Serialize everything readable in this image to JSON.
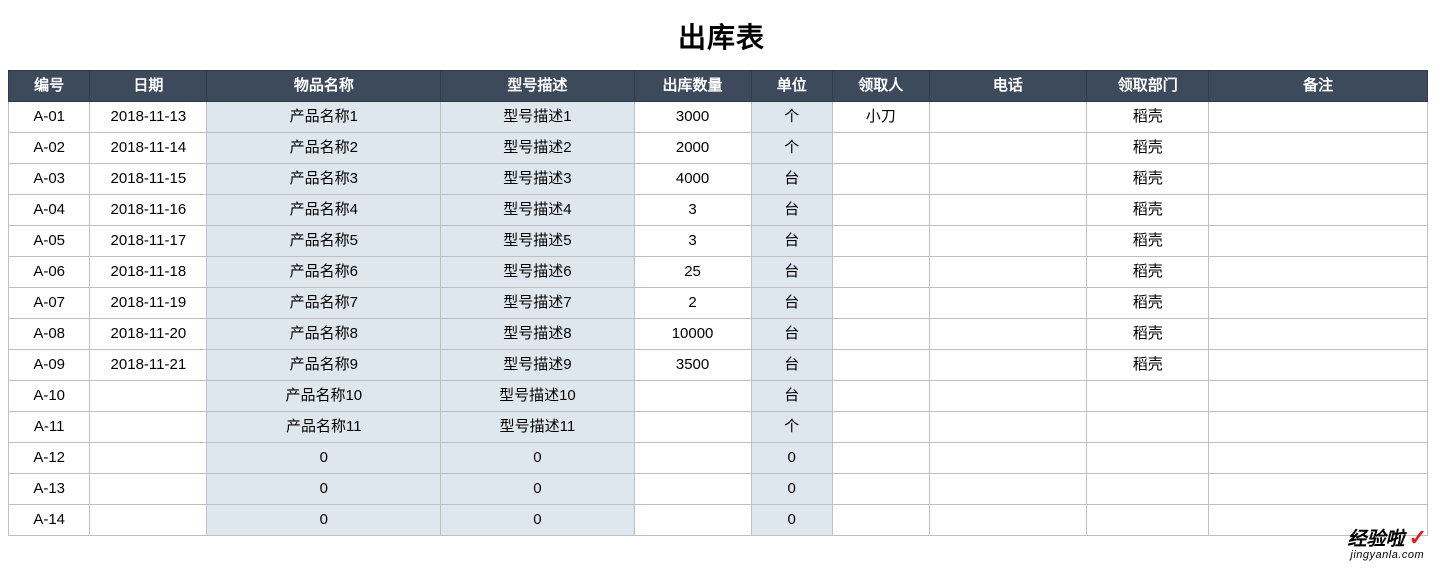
{
  "title": "出库表",
  "headers": [
    "编号",
    "日期",
    "物品名称",
    "型号描述",
    "出库数量",
    "单位",
    "领取人",
    "电话",
    "领取部门",
    "备注"
  ],
  "rows": [
    {
      "id": "A-01",
      "date": "2018-11-13",
      "name": "产品名称1",
      "model": "型号描述1",
      "qty": "3000",
      "unit": "个",
      "receiver": "小刀",
      "phone": "",
      "dept": "稻壳",
      "note": ""
    },
    {
      "id": "A-02",
      "date": "2018-11-14",
      "name": "产品名称2",
      "model": "型号描述2",
      "qty": "2000",
      "unit": "个",
      "receiver": "",
      "phone": "",
      "dept": "稻壳",
      "note": ""
    },
    {
      "id": "A-03",
      "date": "2018-11-15",
      "name": "产品名称3",
      "model": "型号描述3",
      "qty": "4000",
      "unit": "台",
      "receiver": "",
      "phone": "",
      "dept": "稻壳",
      "note": ""
    },
    {
      "id": "A-04",
      "date": "2018-11-16",
      "name": "产品名称4",
      "model": "型号描述4",
      "qty": "3",
      "unit": "台",
      "receiver": "",
      "phone": "",
      "dept": "稻壳",
      "note": ""
    },
    {
      "id": "A-05",
      "date": "2018-11-17",
      "name": "产品名称5",
      "model": "型号描述5",
      "qty": "3",
      "unit": "台",
      "receiver": "",
      "phone": "",
      "dept": "稻壳",
      "note": ""
    },
    {
      "id": "A-06",
      "date": "2018-11-18",
      "name": "产品名称6",
      "model": "型号描述6",
      "qty": "25",
      "unit": "台",
      "receiver": "",
      "phone": "",
      "dept": "稻壳",
      "note": ""
    },
    {
      "id": "A-07",
      "date": "2018-11-19",
      "name": "产品名称7",
      "model": "型号描述7",
      "qty": "2",
      "unit": "台",
      "receiver": "",
      "phone": "",
      "dept": "稻壳",
      "note": ""
    },
    {
      "id": "A-08",
      "date": "2018-11-20",
      "name": "产品名称8",
      "model": "型号描述8",
      "qty": "10000",
      "unit": "台",
      "receiver": "",
      "phone": "",
      "dept": "稻壳",
      "note": ""
    },
    {
      "id": "A-09",
      "date": "2018-11-21",
      "name": "产品名称9",
      "model": "型号描述9",
      "qty": "3500",
      "unit": "台",
      "receiver": "",
      "phone": "",
      "dept": "稻壳",
      "note": ""
    },
    {
      "id": "A-10",
      "date": "",
      "name": "产品名称10",
      "model": "型号描述10",
      "qty": "",
      "unit": "台",
      "receiver": "",
      "phone": "",
      "dept": "",
      "note": ""
    },
    {
      "id": "A-11",
      "date": "",
      "name": "产品名称11",
      "model": "型号描述11",
      "qty": "",
      "unit": "个",
      "receiver": "",
      "phone": "",
      "dept": "",
      "note": ""
    },
    {
      "id": "A-12",
      "date": "",
      "name": "0",
      "model": "0",
      "qty": "",
      "unit": "0",
      "receiver": "",
      "phone": "",
      "dept": "",
      "note": ""
    },
    {
      "id": "A-13",
      "date": "",
      "name": "0",
      "model": "0",
      "qty": "",
      "unit": "0",
      "receiver": "",
      "phone": "",
      "dept": "",
      "note": ""
    },
    {
      "id": "A-14",
      "date": "",
      "name": "0",
      "model": "0",
      "qty": "",
      "unit": "0",
      "receiver": "",
      "phone": "",
      "dept": "",
      "note": ""
    }
  ],
  "watermark": {
    "main": "经验啦",
    "sub": "jingyanla.com"
  }
}
